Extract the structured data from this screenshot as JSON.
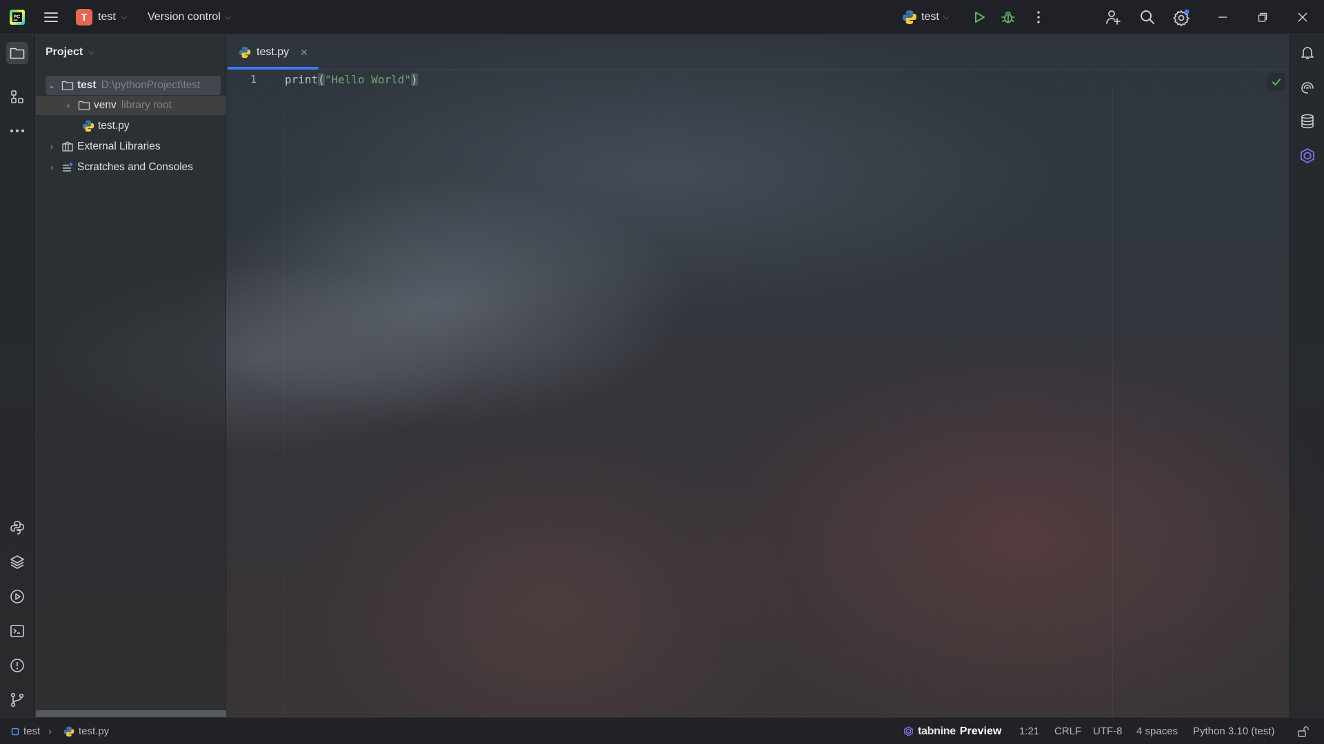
{
  "titlebar": {
    "project_initial": "T",
    "project_name": "test",
    "vcs_label": "Version control",
    "run_config": "test",
    "colors": {
      "project_badge": "#e2694f",
      "run": "#5fb865",
      "debug": "#5fb865"
    }
  },
  "left_strip": {
    "items": [
      "project-icon",
      "structure-icon",
      "more-icon",
      "python-console-icon",
      "layers-icon",
      "services-icon",
      "terminal-icon",
      "problems-icon",
      "git-icon"
    ]
  },
  "project_panel": {
    "title": "Project",
    "tree": [
      {
        "label": "test",
        "hint": "D:\\pythonProject\\test",
        "expanded": true
      },
      {
        "label": "venv",
        "hint": "library root",
        "expanded": false
      },
      {
        "label": "test.py",
        "hint": ""
      },
      {
        "label": "External Libraries",
        "hint": "",
        "expanded": false
      },
      {
        "label": "Scratches and Consoles",
        "hint": "",
        "expanded": false
      }
    ]
  },
  "editor": {
    "tab_label": "test.py",
    "line_numbers": [
      "1"
    ],
    "code": {
      "fn": "print",
      "open": "(",
      "str": "\"Hello World\"",
      "close": ")"
    },
    "accent": "#3d7bf0",
    "string_color": "#6aab73"
  },
  "statusbar": {
    "crumb_project": "test",
    "crumb_file": "test.py",
    "tabnine_brand": "tabnine",
    "tabnine_preview": "Preview",
    "position": "1:21",
    "line_separator": "CRLF",
    "encoding": "UTF-8",
    "indent": "4 spaces",
    "interpreter": "Python 3.10 (test)"
  }
}
